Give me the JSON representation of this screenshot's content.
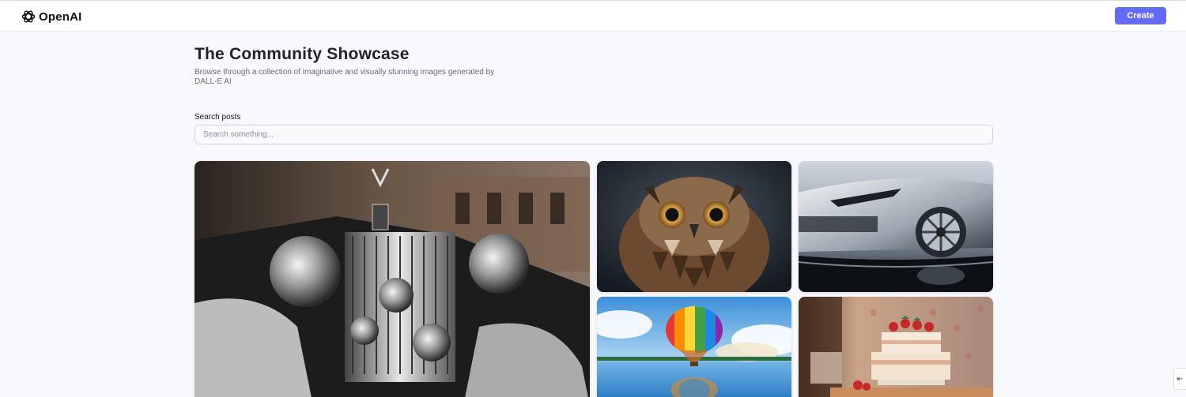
{
  "header": {
    "brand": "OpenAI",
    "logo_icon": "openai-logo-icon",
    "create_label": "Create",
    "accent_color": "#6469ff"
  },
  "main": {
    "title": "The Community Showcase",
    "subtitle": "Browse through a collection of imaginative and visually stunning images generated by DALL-E AI",
    "search": {
      "label": "Search posts",
      "placeholder": "Search something...",
      "value": ""
    }
  },
  "gallery": [
    {
      "subject": "vintage-luxury-car"
    },
    {
      "subject": "owl"
    },
    {
      "subject": "silver-sports-car"
    },
    {
      "subject": "hot-air-balloon"
    },
    {
      "subject": "layered-cake"
    }
  ],
  "corner_tool": {
    "icon": "collapse-arrow-icon"
  }
}
